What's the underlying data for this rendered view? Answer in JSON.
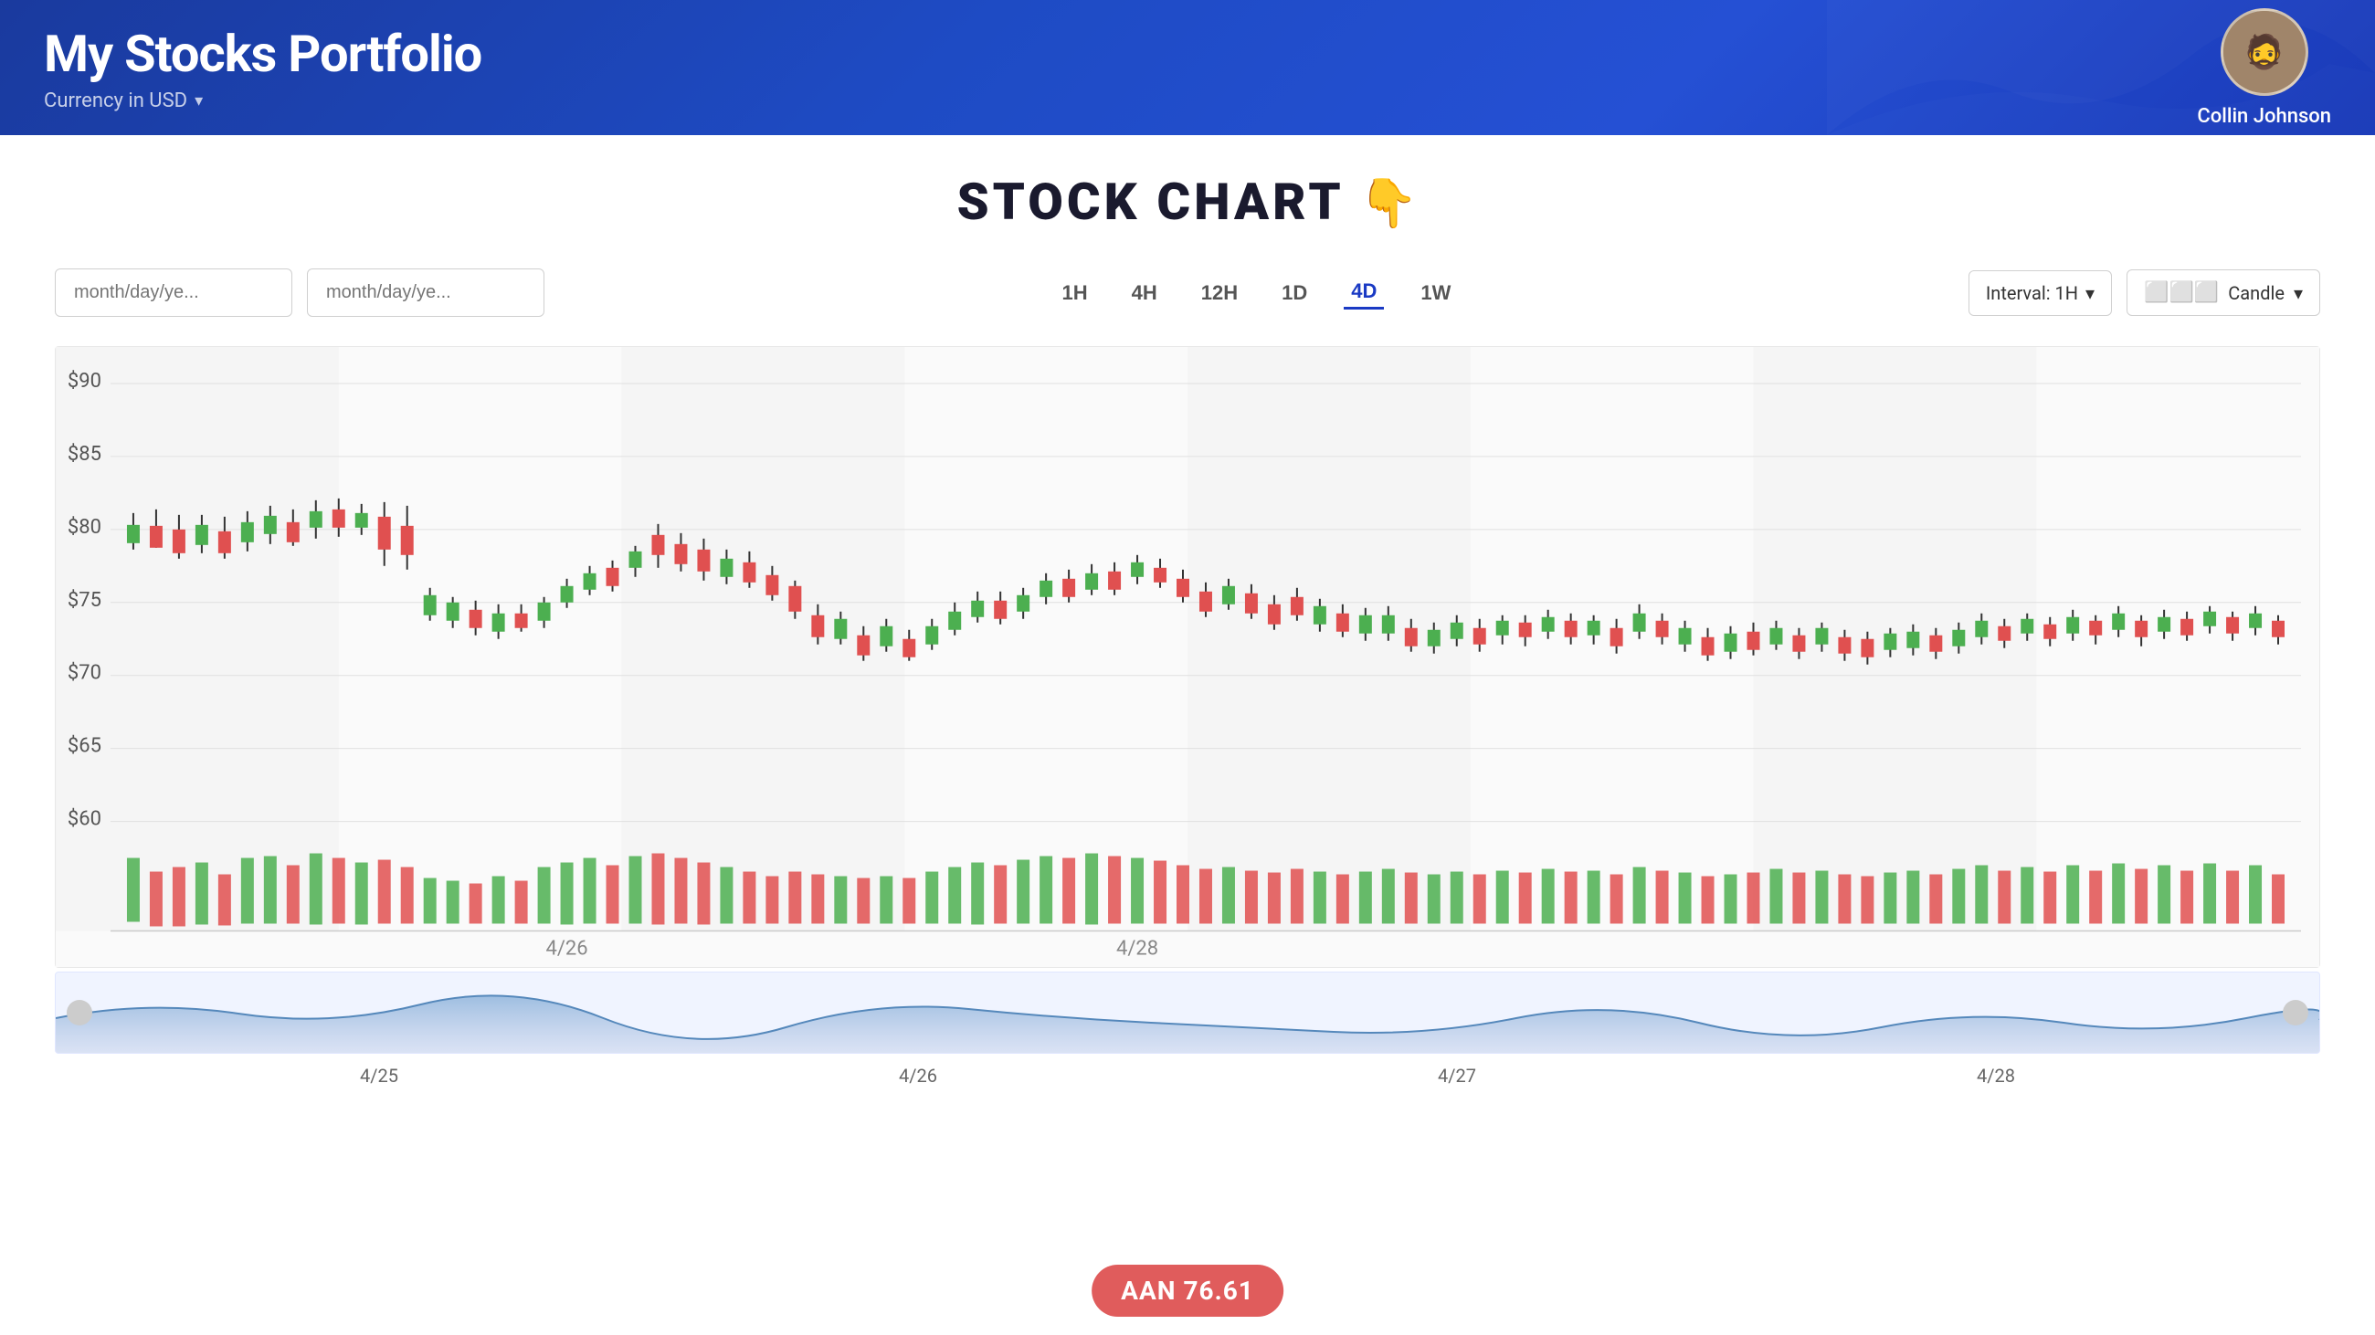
{
  "header": {
    "title": "My Stocks Portfolio",
    "subtitle": "Currency in USD",
    "user_name": "Collin Johnson"
  },
  "page": {
    "chart_title": "STOCK CHART",
    "chart_emoji": "👇"
  },
  "controls": {
    "date_start_placeholder": "month/day/ye...",
    "date_end_placeholder": "month/day/ye...",
    "time_filters": [
      "1H",
      "4H",
      "12H",
      "1D",
      "4D",
      "1W"
    ],
    "active_filter": "4D",
    "interval_label": "Interval: 1H",
    "chart_type_label": "Candle",
    "interval_icon": "▾",
    "candle_icon": "▾"
  },
  "chart": {
    "y_labels": [
      "$90",
      "$85",
      "$80",
      "$75",
      "$70",
      "$65",
      "$60"
    ],
    "x_labels": [
      "4/25",
      "4/26",
      "4/27",
      "4/28"
    ],
    "ticker": "AAN  76.61"
  }
}
